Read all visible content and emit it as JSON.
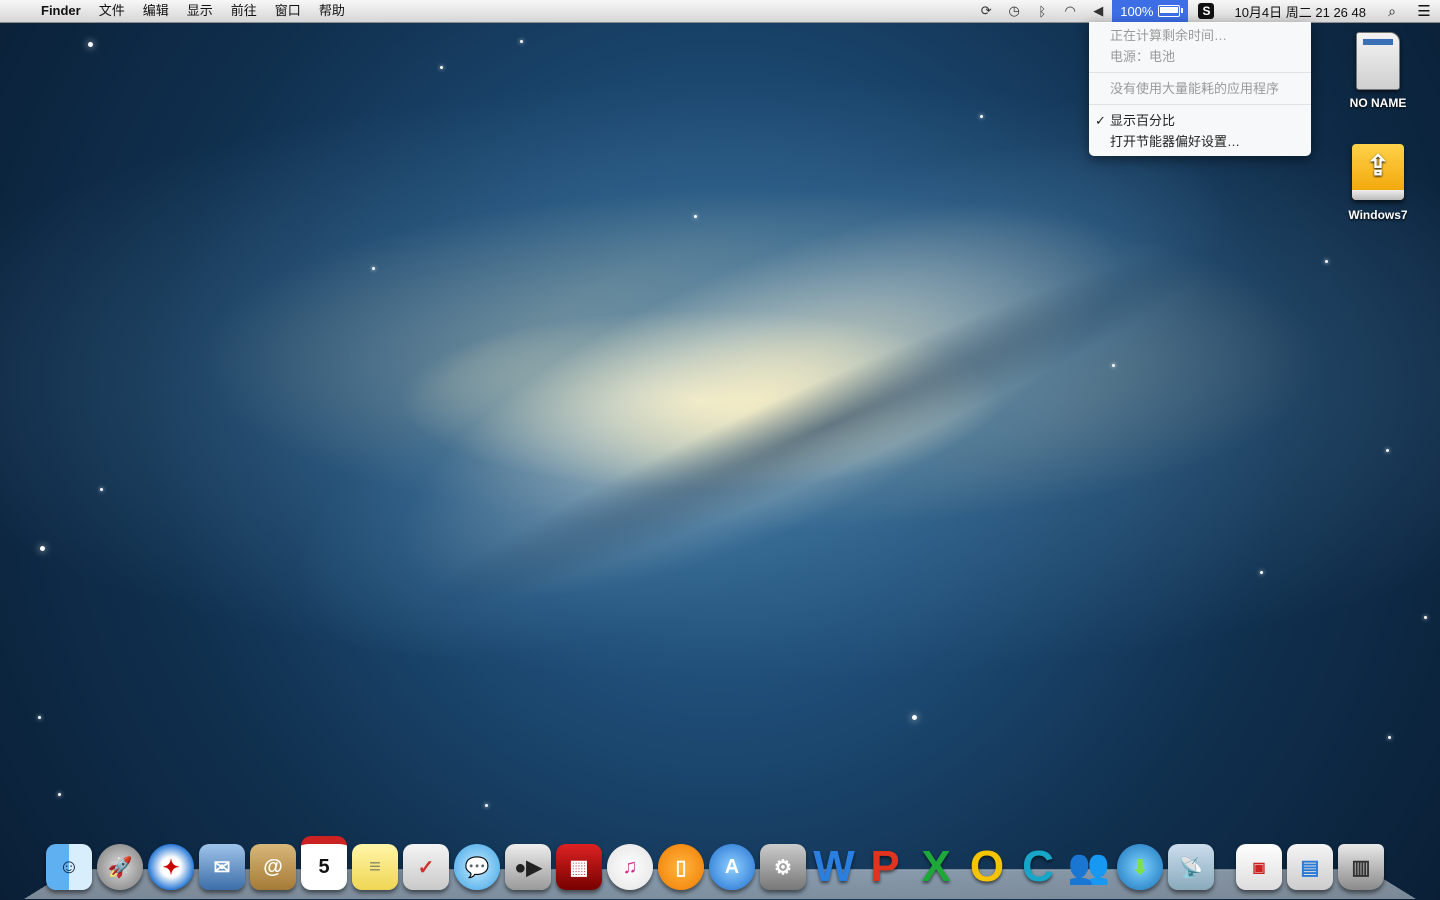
{
  "menubar": {
    "apple_icon": "",
    "app_name": "Finder",
    "items": [
      "文件",
      "编辑",
      "显示",
      "前往",
      "窗口",
      "帮助"
    ],
    "status_icons": [
      "sync-icon",
      "time-machine-icon",
      "bluetooth-icon",
      "wifi-icon",
      "volume-icon"
    ],
    "battery_percent": "100%",
    "battery_level": 1.0,
    "input_method": "S",
    "clock": "10月4日 周二 21 26 48"
  },
  "battery_menu": {
    "line1": "正在计算剩余时间…",
    "line2": "电源：电池",
    "energy": "没有使用大量能耗的应用程序",
    "show_percent": "显示百分比",
    "check": "✓",
    "prefs": "打开节能器偏好设置…"
  },
  "desktop": {
    "icon1_label": "NO NAME",
    "icon2_label": "Windows7"
  },
  "dock": {
    "icons": [
      "finder",
      "launchpad",
      "safari",
      "mail",
      "contacts",
      "calendar",
      "notes",
      "reminders",
      "messages",
      "facetime",
      "photo-booth",
      "itunes",
      "ibooks",
      "app-store",
      "system-preferences",
      "word",
      "powerpoint",
      "excel",
      "outlook",
      "communicator",
      "lync",
      "download",
      "network",
      "winclone",
      "preview",
      "trash"
    ],
    "calendar_day": "5",
    "letters": {
      "word": "W",
      "powerpoint": "P",
      "excel": "X",
      "outlook": "O",
      "communicator": "C"
    }
  },
  "colors": {
    "battery_highlight": "#3d6ee6"
  }
}
